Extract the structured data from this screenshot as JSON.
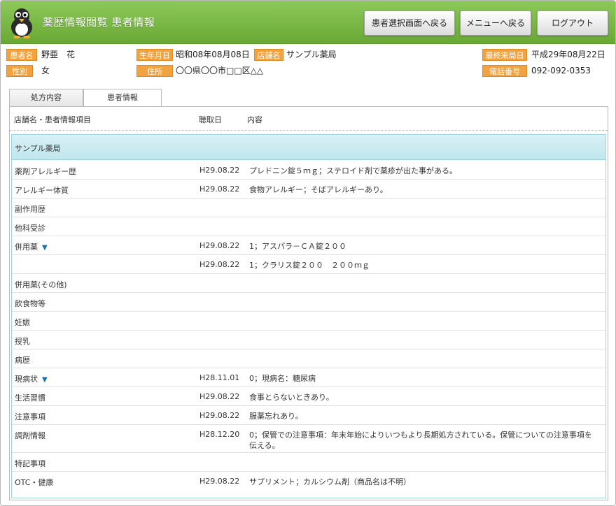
{
  "header": {
    "title": "薬歴情報閲覧 患者情報",
    "buttons": {
      "patient_select": "患者選択画面へ戻る",
      "menu": "メニューへ戻る",
      "logout": "ログアウト"
    }
  },
  "patient": {
    "name_label": "患者名",
    "name": "野亜　花",
    "sex_label": "性別",
    "sex": "女",
    "birth_label": "生年月日",
    "birth": "昭和08年08月08日",
    "store_label": "店舗名",
    "store": "サンプル薬局",
    "address_label": "住所",
    "address": "〇〇県〇〇市□□区△△",
    "last_visit_label": "最終来局日",
    "last_visit": "平成29年08月22日",
    "phone_label": "電話番号",
    "phone": "092-092-0353"
  },
  "tabs": [
    "処方内容",
    "患者情報"
  ],
  "columns": {
    "store_item": "店舗名・患者情報項目",
    "date": "聴取日",
    "content": "内容"
  },
  "store_name": "サンプル薬局",
  "rows": [
    {
      "name": "薬剤アレルギー歴",
      "date": "H29.08.22",
      "content": "プレドニン錠５ｍｇ；ステロイド剤で薬疹が出た事がある。"
    },
    {
      "name": "アレルギー体質",
      "date": "H29.08.22",
      "content": "食物アレルギー；そばアレルギーあり。"
    },
    {
      "name": "副作用歴",
      "date": "",
      "content": ""
    },
    {
      "name": "他科受診",
      "date": "",
      "content": ""
    },
    {
      "name": "併用薬",
      "date": "H29.08.22",
      "content": "1；アスパラ－ＣＡ錠２００"
    },
    {
      "name": "",
      "date": "H29.08.22",
      "content": "1；クラリス錠２００　２００ｍｇ"
    },
    {
      "name": "併用薬(その他)",
      "date": "",
      "content": ""
    },
    {
      "name": "飲食物等",
      "date": "",
      "content": ""
    },
    {
      "name": "妊娠",
      "date": "",
      "content": ""
    },
    {
      "name": "授乳",
      "date": "",
      "content": ""
    },
    {
      "name": "病歴",
      "date": "",
      "content": ""
    },
    {
      "name": "現病状",
      "date": "H28.11.01",
      "content": "0；現病名：糖尿病"
    },
    {
      "name": "生活習慣",
      "date": "H29.08.22",
      "content": "食事とらないときあり。"
    },
    {
      "name": "注意事項",
      "date": "H29.08.22",
      "content": "服薬忘れあり。"
    },
    {
      "name": "調剤情報",
      "date": "H28.12.20",
      "content": "0；保管での注意事項：年末年始によりいつもより長期処方されている。保管についての注意事項を伝える。"
    },
    {
      "name": "特記事項",
      "date": "",
      "content": ""
    },
    {
      "name": "OTC・健康",
      "date": "H29.08.22",
      "content": "サプリメント；カルシウム剤（商品名は不明）"
    }
  ],
  "colors": {
    "header_green": "#7ab845",
    "label_orange": "#f2a341",
    "store_header": "#c9ebf2",
    "expand_icon": "#1a6fb0"
  },
  "icons": {
    "logo": "penguin-mascot-icon",
    "expand": "triangle-down-icon"
  }
}
